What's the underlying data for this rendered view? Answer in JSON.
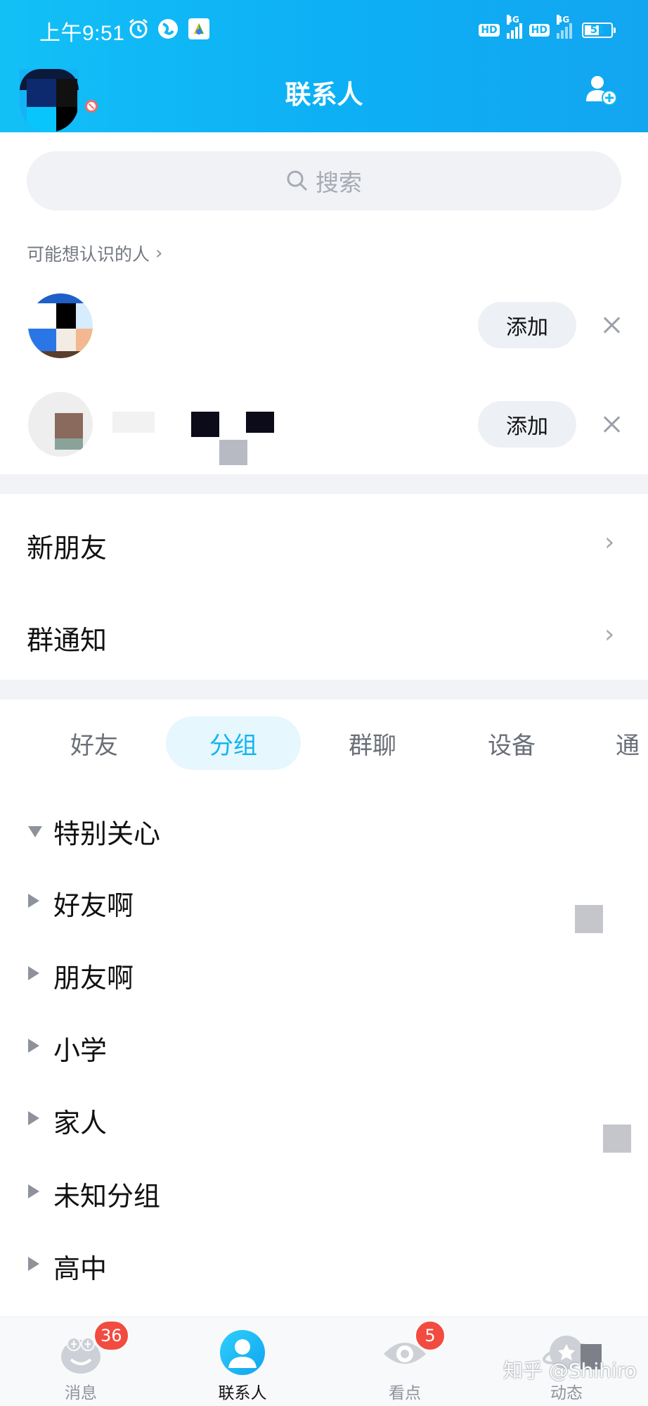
{
  "status_bar": {
    "time": "上午9:51",
    "hd1": "HD",
    "hd2": "HD",
    "net1": "4G",
    "net2": "4G",
    "battery": "51"
  },
  "header": {
    "title": "联系人"
  },
  "search": {
    "placeholder": "搜索"
  },
  "suggestions": {
    "title": "可能想认识的人",
    "add_label": "添加"
  },
  "menu": {
    "items": [
      {
        "label": "新朋友"
      },
      {
        "label": "群通知"
      }
    ]
  },
  "tabs": {
    "items": [
      {
        "label": "好友"
      },
      {
        "label": "分组"
      },
      {
        "label": "群聊"
      },
      {
        "label": "设备"
      },
      {
        "label": "通"
      }
    ],
    "active": "分组"
  },
  "groups": {
    "items": [
      {
        "label": "特别关心",
        "expanded": true
      },
      {
        "label": "好友啊",
        "expanded": false
      },
      {
        "label": "朋友啊",
        "expanded": false
      },
      {
        "label": "小学",
        "expanded": false
      },
      {
        "label": "家人",
        "expanded": false
      },
      {
        "label": "未知分组",
        "expanded": false
      },
      {
        "label": "高中",
        "expanded": false
      }
    ]
  },
  "bottom_nav": {
    "items": [
      {
        "label": "消息",
        "badge": "36",
        "icon": "penguin-message-icon"
      },
      {
        "label": "联系人",
        "badge": "",
        "icon": "contacts-person-icon"
      },
      {
        "label": "看点",
        "badge": "5",
        "icon": "eye-icon"
      },
      {
        "label": "动态",
        "badge": "",
        "icon": "planet-star-icon"
      }
    ]
  },
  "watermark": "知乎 @Shihiro",
  "colors": {
    "header": "#13b8f5",
    "accent": "#13b5ef",
    "badge": "#f24b40"
  }
}
